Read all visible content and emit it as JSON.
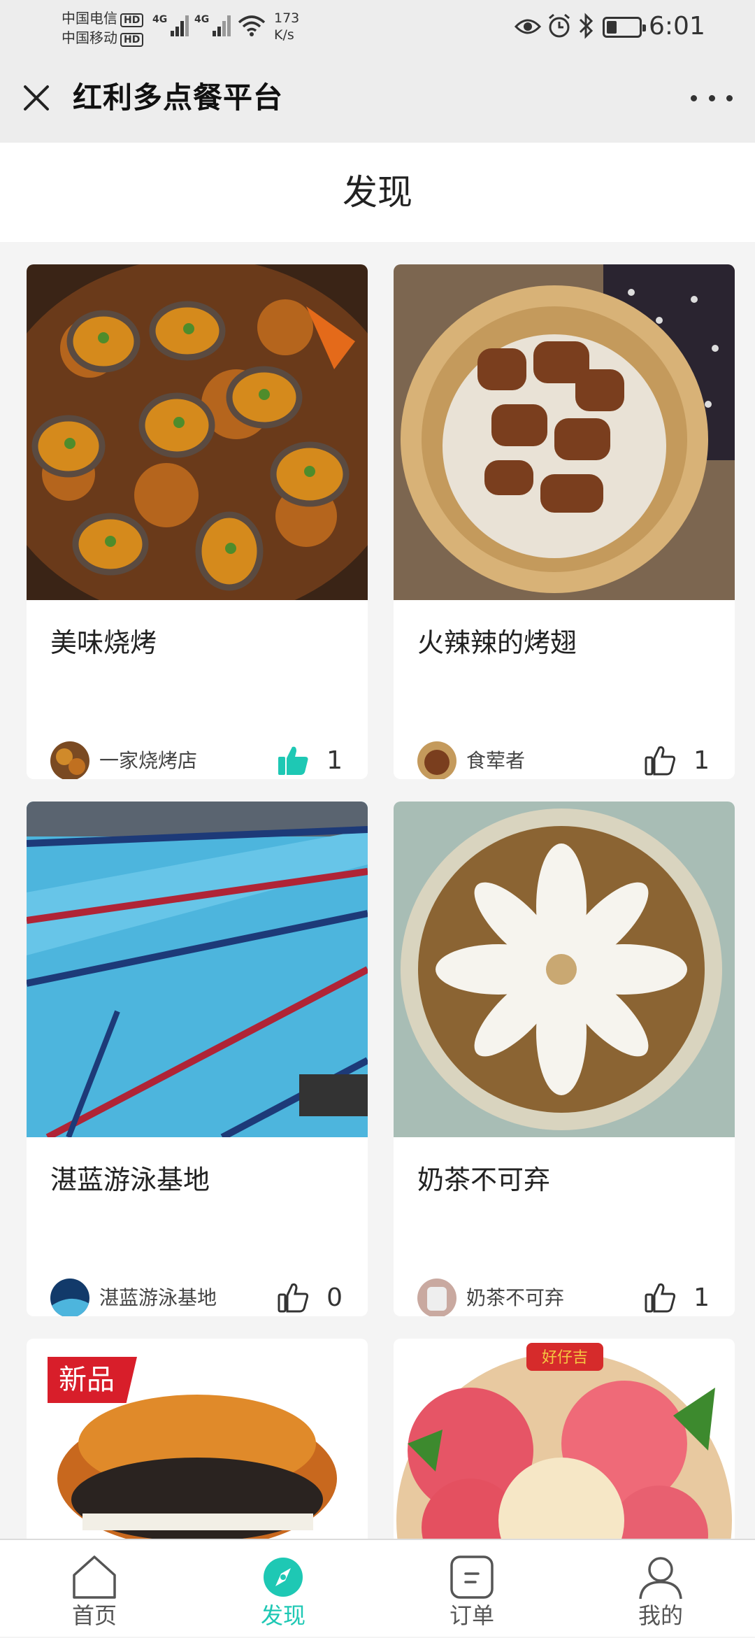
{
  "status_bar": {
    "carrier1": "中国电信",
    "carrier2": "中国移动",
    "hd": "HD",
    "network": "4G",
    "speed_value": "173",
    "speed_unit": "K/s",
    "time": "6:01"
  },
  "header": {
    "title": "红利多点餐平台"
  },
  "page": {
    "title": "发现"
  },
  "feed": [
    {
      "title": "美味烧烤",
      "author": "一家烧烤店",
      "likes": "1",
      "liked": true
    },
    {
      "title": "火辣辣的烤翅",
      "author": "食荤者",
      "likes": "1",
      "liked": false
    },
    {
      "title": "湛蓝游泳基地",
      "author": "湛蓝游泳基地",
      "likes": "0",
      "liked": false
    },
    {
      "title": "奶茶不可弃",
      "author": "奶茶不可弃",
      "likes": "1",
      "liked": false
    },
    {
      "badge": "新品"
    },
    {
      "brand": "好仔吉"
    }
  ],
  "tabbar": {
    "items": [
      {
        "label": "首页",
        "icon": "home-icon"
      },
      {
        "label": "发现",
        "icon": "compass-icon"
      },
      {
        "label": "订单",
        "icon": "order-icon"
      },
      {
        "label": "我的",
        "icon": "profile-icon"
      }
    ],
    "active": "发现"
  },
  "colors": {
    "accent": "#1ec8b4",
    "badge": "#d81e2a",
    "header_bg": "#ededed"
  }
}
